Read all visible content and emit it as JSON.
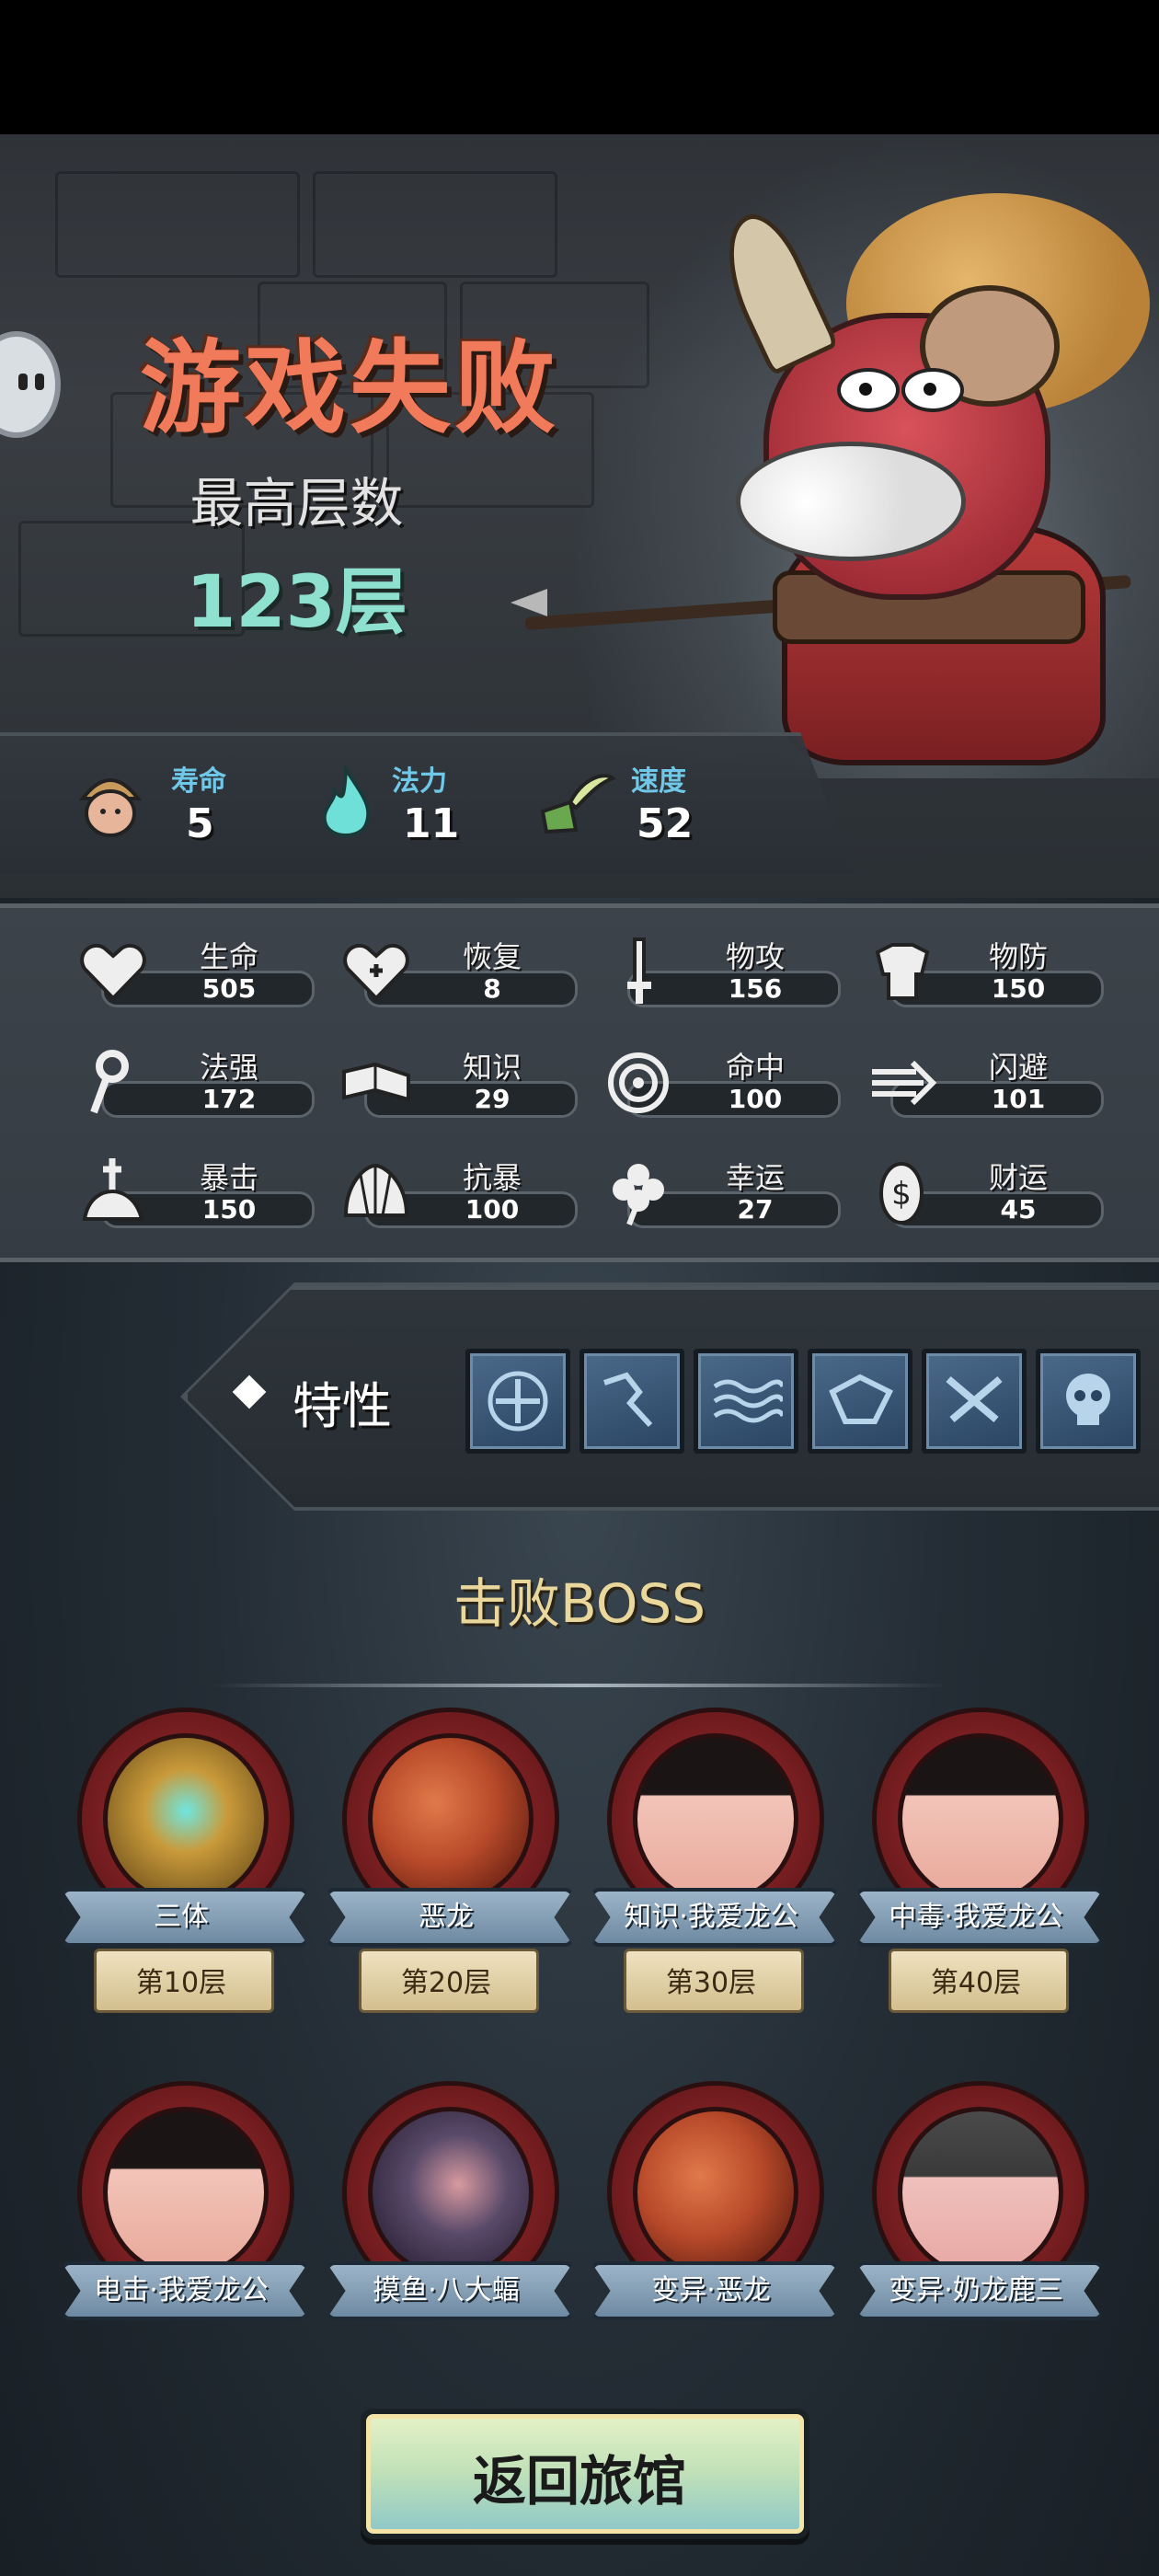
{
  "header": {
    "title": "游戏失败",
    "highest_floor_label": "最高层数",
    "highest_floor_value": "123层"
  },
  "top_stats": [
    {
      "label": "寿命",
      "value": "5",
      "icon": "monk-icon"
    },
    {
      "label": "法力",
      "value": "11",
      "icon": "flame-icon"
    },
    {
      "label": "速度",
      "value": "52",
      "icon": "winged-boot-icon"
    }
  ],
  "stats": [
    {
      "label": "生命",
      "value": "505",
      "icon": "heart-icon"
    },
    {
      "label": "恢复",
      "value": "8",
      "icon": "heart-plus-icon"
    },
    {
      "label": "物攻",
      "value": "156",
      "icon": "sword-icon"
    },
    {
      "label": "物防",
      "value": "150",
      "icon": "armor-icon"
    },
    {
      "label": "法强",
      "value": "172",
      "icon": "staff-icon"
    },
    {
      "label": "知识",
      "value": "29",
      "icon": "book-icon"
    },
    {
      "label": "命中",
      "value": "100",
      "icon": "target-icon"
    },
    {
      "label": "闪避",
      "value": "101",
      "icon": "dash-icon"
    },
    {
      "label": "暴击",
      "value": "150",
      "icon": "crit-burst-icon"
    },
    {
      "label": "抗暴",
      "value": "100",
      "icon": "shell-icon"
    },
    {
      "label": "幸运",
      "value": "27",
      "icon": "clover-icon"
    },
    {
      "label": "财运",
      "value": "45",
      "icon": "coin-icon"
    }
  ],
  "traits": {
    "label": "特性",
    "icons": [
      "clover-trait-icon",
      "crack-trait-icon",
      "wave-trait-icon",
      "shield-trait-icon",
      "crossed-guns-trait-icon",
      "skull-trait-icon"
    ]
  },
  "bosses": {
    "title": "击败BOSS",
    "items": [
      {
        "name": "三体",
        "floor": "第10层",
        "portrait": "golden-robot-portrait"
      },
      {
        "name": "恶龙",
        "floor": "第20层",
        "portrait": "red-dragon-portrait"
      },
      {
        "name": "知识·我爱龙公",
        "floor": "第30层",
        "portrait": "princess-portrait"
      },
      {
        "name": "中毒·我爱龙公",
        "floor": "第40层",
        "portrait": "princess-portrait"
      },
      {
        "name": "电击·我爱龙公",
        "floor": "",
        "portrait": "princess-portrait"
      },
      {
        "name": "摸鱼·八大蝠",
        "floor": "",
        "portrait": "purple-bird-portrait"
      },
      {
        "name": "变异·恶龙",
        "floor": "",
        "portrait": "red-dragon-portrait"
      },
      {
        "name": "变异·奶龙鹿三",
        "floor": "",
        "portrait": "helmet-baby-portrait"
      }
    ]
  },
  "return_button": "返回旅馆",
  "colors": {
    "title": "#f07a5a",
    "floor_value": "#8ee0cf",
    "top_stat_label": "#6fc8e8",
    "boss_title": "#e9d79c",
    "boss_frame": "#a32e2e",
    "trait_tile": "#4a6a8a"
  }
}
